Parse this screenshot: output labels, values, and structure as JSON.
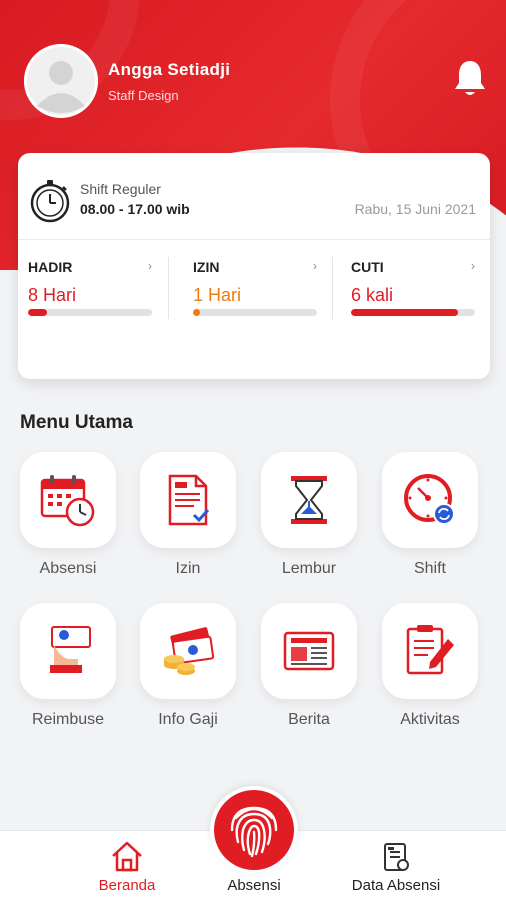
{
  "user": {
    "name": "Angga Setiadji",
    "role": "Staff Design"
  },
  "shift": {
    "name": "Shift Reguler",
    "time": "08.00 - 17.00 wib",
    "date": "Rabu, 15 Juni 2021"
  },
  "stats": [
    {
      "label": "HADIR",
      "value": "8 Hari",
      "color": "#e11d24",
      "progress": 0.15
    },
    {
      "label": "IZIN",
      "value": "1 Hari",
      "color": "#f07a12",
      "progress": 0.06
    },
    {
      "label": "CUTI",
      "value": "6 kali",
      "color": "#e11d24",
      "progress": 0.86
    }
  ],
  "menu": {
    "title": "Menu Utama",
    "items": [
      {
        "label": "Absensi",
        "icon": "calendar-clock-icon"
      },
      {
        "label": "Izin",
        "icon": "document-check-icon"
      },
      {
        "label": "Lembur",
        "icon": "hourglass-icon"
      },
      {
        "label": "Shift",
        "icon": "clock-refresh-icon"
      },
      {
        "label": "Reimbuse",
        "icon": "hand-money-icon"
      },
      {
        "label": "Info Gaji",
        "icon": "money-coins-icon"
      },
      {
        "label": "Berita",
        "icon": "newspaper-icon"
      },
      {
        "label": "Aktivitas",
        "icon": "clipboard-pen-icon"
      }
    ]
  },
  "nav": {
    "home": "Beranda",
    "attendance": "Absensi",
    "data": "Data Absensi"
  },
  "colors": {
    "primary": "#e11d24",
    "accent": "#f07a12",
    "background": "#f2f3f5"
  }
}
